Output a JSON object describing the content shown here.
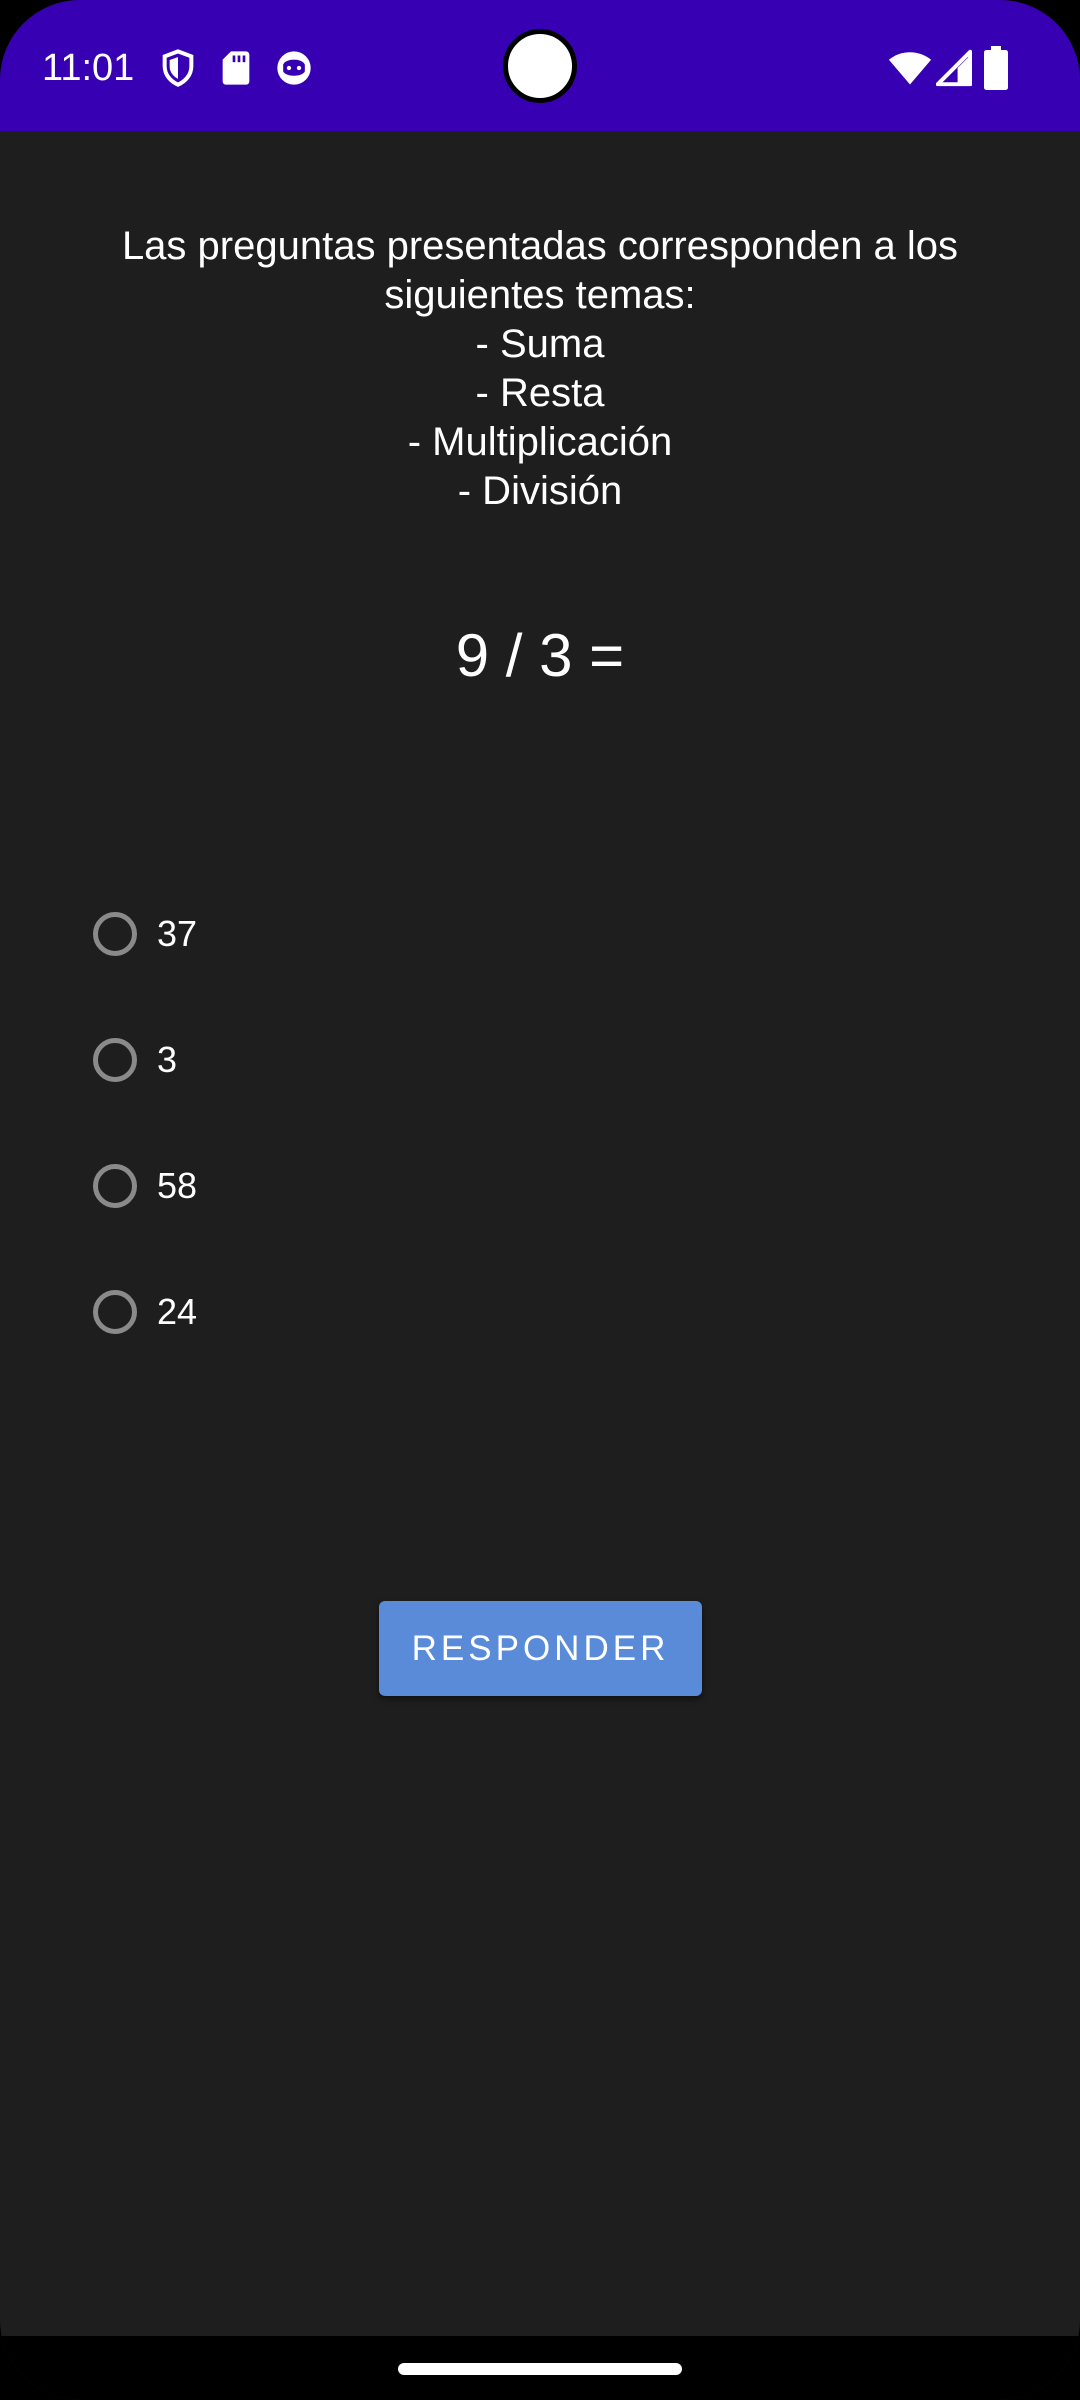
{
  "status_bar": {
    "time": "11:01",
    "left_icons": [
      "shield-icon",
      "sd-card-icon",
      "game-controller-icon"
    ],
    "right_icons": [
      "wifi-icon",
      "cell-signal-icon",
      "battery-icon"
    ],
    "background_color": "#3700b3"
  },
  "quiz": {
    "topics_intro_line1": "Las preguntas presentadas corresponden a los",
    "topics_intro_line2": "siguientes temas:",
    "topics": [
      "- Suma",
      "- Resta",
      "- Multiplicación",
      "- División"
    ],
    "question": "9 / 3 =",
    "options": [
      "37",
      "3",
      "58",
      "24"
    ],
    "selected_option": null,
    "submit_label": "RESPONDER",
    "accent_color": "#5a8bd9"
  }
}
